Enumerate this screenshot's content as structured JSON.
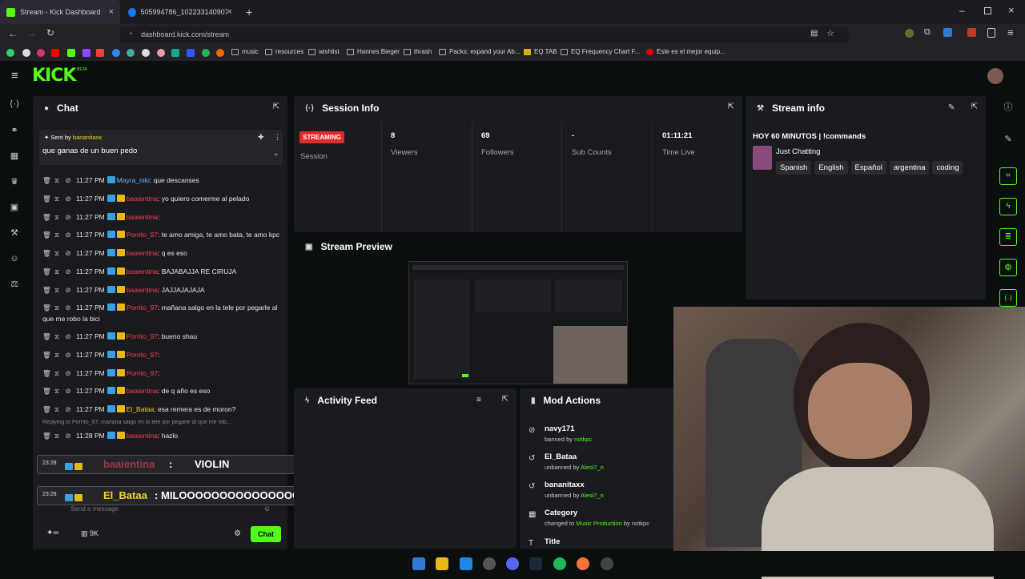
{
  "browser": {
    "tabs": [
      {
        "title": "Stream - Kick Dashboard",
        "active": true
      },
      {
        "title": "505994786_102233140907508",
        "active": false
      }
    ],
    "url": "dashboard.kick.com/stream",
    "bookmarks": [
      "music",
      "resources",
      "wishlist",
      "Hannes Bieger",
      "thrash",
      "Packs: expand your Ab...",
      "EQ TAB",
      "EQ Frequency Chart F...",
      "Este es el mejor equip..."
    ]
  },
  "kick": {
    "logo": "KICK",
    "logo_sup": "BETA",
    "accent": "#53fc18"
  },
  "chat": {
    "title": "Chat",
    "pinned_prefix": "Sent by",
    "pinned_user": "bananitaxx",
    "pinned_text": "que ganas de un buen pedo",
    "messages": [
      {
        "time": "11:27 PM",
        "user": "Mayra_niki",
        "text": ": que descanses"
      },
      {
        "time": "11:27 PM",
        "user": "baaientina",
        "text": ": yo quiero comerme al pelado"
      },
      {
        "time": "11:27 PM",
        "user": "baaientina",
        "text": ":"
      },
      {
        "time": "11:27 PM",
        "user": "Porrito_97",
        "text": ": te amo amiga, te amo bata, te amo kpc"
      },
      {
        "time": "11:27 PM",
        "user": "baaientina",
        "text": ": q es eso"
      },
      {
        "time": "11:27 PM",
        "user": "baaientina",
        "text": ": BAJABAJJA RE CIRUJA"
      },
      {
        "time": "11:27 PM",
        "user": "baaientina",
        "text": ": JAJJAJAJAJA"
      },
      {
        "time": "11:27 PM",
        "user": "Porrito_97",
        "text": ": mañana salgo en la tele por pegarle al"
      },
      {
        "time": "",
        "user": "",
        "text": "que me robo la bici"
      },
      {
        "time": "11:27 PM",
        "user": "Porrito_97",
        "text": ": bueno shau"
      },
      {
        "time": "11:27 PM",
        "user": "Porrito_97",
        "text": ":"
      },
      {
        "time": "11:27 PM",
        "user": "Porrito_97",
        "text": ":"
      },
      {
        "time": "11:27 PM",
        "user": "baaientina",
        "text": ": de q año es eso"
      },
      {
        "time": "11:27 PM",
        "user": "El_Bataa",
        "text": ": esa remera es de moron?"
      },
      {
        "time": "11:28 PM",
        "user": "baaientina",
        "text": ": hazlo"
      }
    ],
    "reply_hint": "Replying to Porrito_97: mañana salgo en la tele por pegarle al que me rob...",
    "input_placeholder": "Send a message",
    "viewers_short": "9K",
    "chat_button": "Chat"
  },
  "overlay": [
    {
      "time": "23:28",
      "user": "baaientina",
      "text": "VIOLIN"
    },
    {
      "time": "23:28",
      "user": "El_Bataa",
      "text": "MILOOOOOOOOOOOOOOOOOOOOOOO"
    }
  ],
  "session": {
    "title": "Session Info",
    "status": "STREAMING",
    "status_label": "Session",
    "stats": [
      {
        "value": "8",
        "label": "Viewers"
      },
      {
        "value": "69",
        "label": "Followers"
      },
      {
        "value": "-",
        "label": "Sub Counts"
      },
      {
        "value": "01:11:21",
        "label": "Time Live"
      }
    ]
  },
  "stream_info": {
    "title": "Stream info",
    "stream_title": "HOY 60 MINUTOS | !commands",
    "category": "Just Chatting",
    "tags": [
      "Spanish",
      "English",
      "Español",
      "argentina",
      "coding"
    ]
  },
  "preview": {
    "title": "Stream Preview"
  },
  "activity": {
    "title": "Activity Feed"
  },
  "mod_actions": {
    "title": "Mod Actions",
    "items": [
      {
        "icon": "ban-icon",
        "name": "navy171",
        "action": "banned by",
        "by": "notkpc"
      },
      {
        "icon": "undo-icon",
        "name": "El_Bataa",
        "action": "unbanned by",
        "by": "Alesi7_n"
      },
      {
        "icon": "undo-icon",
        "name": "bananitaxx",
        "action": "unbanned by",
        "by": "Alesi7_n"
      },
      {
        "icon": "category-icon",
        "name": "Category",
        "action": "changed to",
        "by": "Music Production",
        "suffix": "by notkpc"
      },
      {
        "icon": "title-icon",
        "name": "Title",
        "action": "",
        "by": ""
      }
    ]
  }
}
